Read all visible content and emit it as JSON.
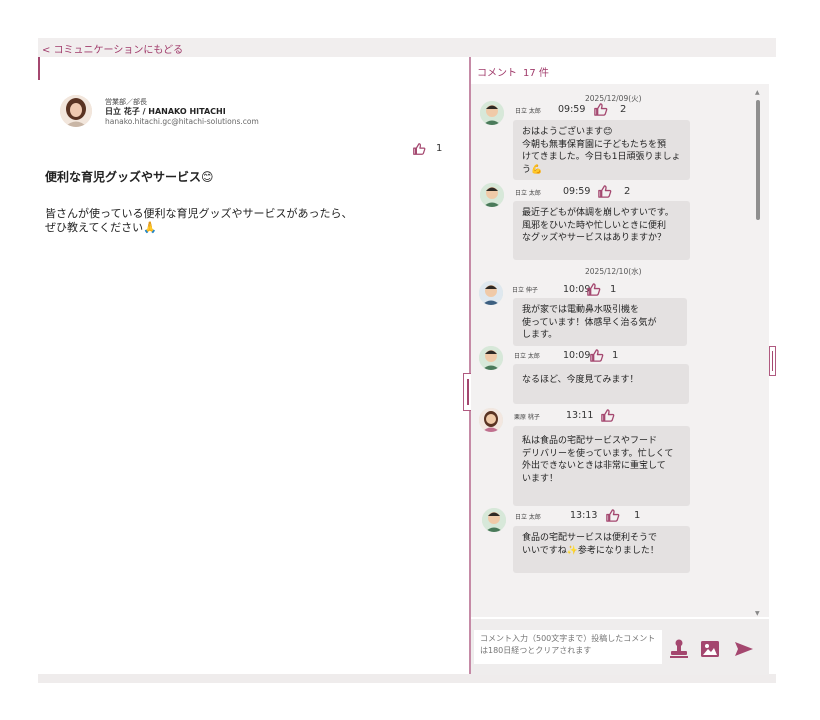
{
  "nav": {
    "back_label": "< コミュニケーションにもどる"
  },
  "post": {
    "author": {
      "department": "営業部／部長",
      "name": "日立 花子 / HANAKO HITACHI",
      "email": "hanako.hitachi.gc@hitachi-solutions.com"
    },
    "likes": "1",
    "title": "便利な育児グッズやサービス😊",
    "body_line1": "皆さんが使っている便利な育児グッズやサービスがあったら、",
    "body_line2": "ぜひ教えてください🙏"
  },
  "comments_panel": {
    "title": "コメント",
    "count": "17 件",
    "days": [
      "2025/12/09(火)",
      "2025/12/10(水)"
    ],
    "comments": [
      {
        "name": "日立 太郎",
        "time": "09:59",
        "likes": "2",
        "lines": [
          "おはようございます😊",
          "今朝も無事保育園に子どもたちを預",
          "けてきました。今日も1日頑張りましょ",
          "う💪"
        ]
      },
      {
        "name": "日立 太郎",
        "time": "09:59",
        "likes": "2",
        "lines": [
          "最近子どもが体調を崩しやすいです。",
          "風邪をひいた時や忙しいときに便利",
          "なグッズやサービスはありますか？"
        ]
      },
      {
        "name": "日立 伸子",
        "time": "10:09",
        "likes": "1",
        "lines": [
          "我が家では電動鼻水吸引機を",
          "使っています！体感早く治る気が",
          "します。"
        ]
      },
      {
        "name": "日立 太郎",
        "time": "10:09",
        "likes": "1",
        "lines": [
          "なるほど、今度見てみます！"
        ]
      },
      {
        "name": "栗原 桃子",
        "time": "13:11",
        "likes": "",
        "lines": [
          "私は食品の宅配サービスやフード",
          "デリバリーを使っています。忙しくて",
          "外出できないときは非常に重宝して",
          "います！"
        ]
      },
      {
        "name": "日立 太郎",
        "time": "13:13",
        "likes": "1",
        "lines": [
          "食品の宅配サービスは便利そうで",
          "いいですね✨参考になりました！"
        ]
      }
    ]
  },
  "composer": {
    "placeholder": "コメント入力（500文字まで）投稿したコメントは180日経つとクリアされます"
  },
  "icons": {
    "like": "thumbs-up-icon",
    "stamp": "stamp-icon",
    "image": "image-icon",
    "send": "send-icon"
  },
  "colors": {
    "accent": "#a4476f",
    "bubble": "#e4e1e1"
  }
}
